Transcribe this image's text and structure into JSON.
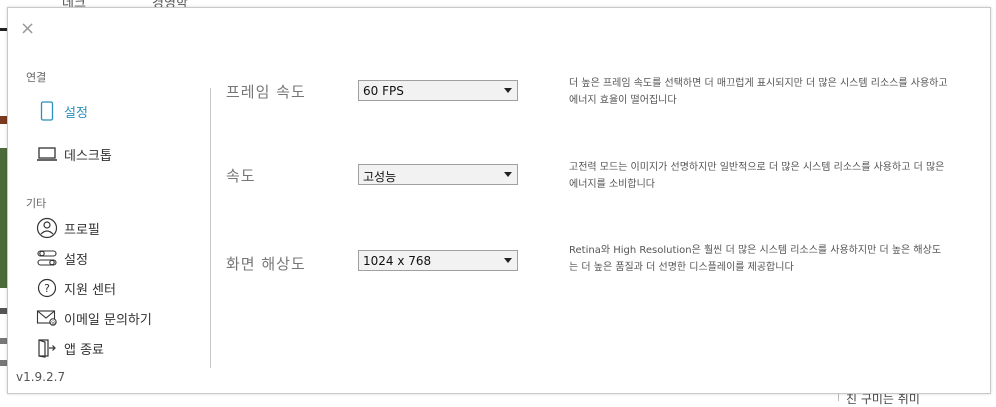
{
  "background": {
    "top_fragments": [
      "데크",
      "경영학"
    ],
    "bottom_fragment": "친 구미는 취미"
  },
  "dialog": {
    "close_label": "×",
    "sidebar": {
      "section_connection": "연결",
      "section_etc": "기타",
      "items": [
        {
          "label": "설정",
          "icon": "mobile-icon"
        },
        {
          "label": "데스크톱",
          "icon": "laptop-icon"
        },
        {
          "label": "프로필",
          "icon": "profile-icon"
        },
        {
          "label": "설정",
          "icon": "toggle-settings-icon"
        },
        {
          "label": "지원 센터",
          "icon": "help-icon"
        },
        {
          "label": "이메일 문의하기",
          "icon": "mail-icon"
        },
        {
          "label": "앱 종료",
          "icon": "exit-icon"
        }
      ],
      "version": "v1.9.2.7"
    },
    "settings": [
      {
        "label": "프레임 속도",
        "value": "60 FPS",
        "description": "더 높은 프레임 속도를 선택하면 더 매끄럽게 표시되지만 더 많은 시스템 리소스를 사용하고 에너지 효율이 떨어집니다"
      },
      {
        "label": "속도",
        "value": "고성능",
        "description": "고전력 모드는 이미지가 선명하지만 일반적으로 더 많은 시스템 리소스를 사용하고 더 많은 에너지를 소비합니다"
      },
      {
        "label": "화면 해상도",
        "value": "1024 x 768",
        "description": "Retina와 High Resolution은 훨씬 더 많은 시스템 리소스를 사용하지만 더 높은 해상도는 더 높은 품질과 더 선명한 디스플레이를 제공합니다"
      }
    ],
    "colors": {
      "accent": "#2a8fbd",
      "border": "#c8c8c8"
    }
  }
}
